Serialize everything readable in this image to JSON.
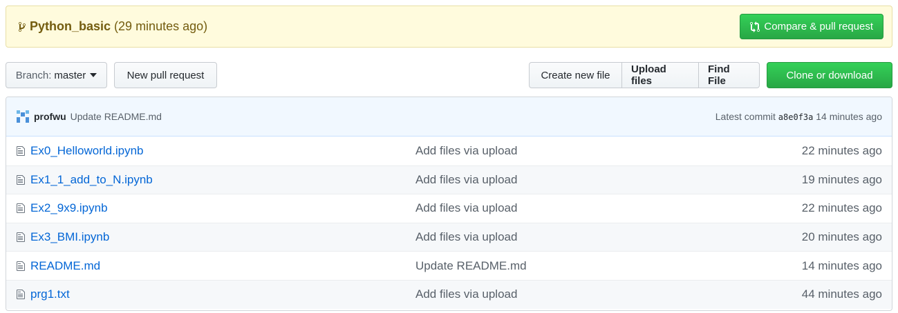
{
  "banner": {
    "branch_name": "Python_basic",
    "branch_time": "(29 minutes ago)",
    "compare_label": "Compare & pull request"
  },
  "toolbar": {
    "branch_prefix": "Branch:",
    "branch_value": "master",
    "new_pr_label": "New pull request",
    "create_file_label": "Create new file",
    "upload_files_label": "Upload files",
    "find_file_label": "Find File",
    "clone_label": "Clone or download"
  },
  "commit": {
    "author": "profwu",
    "message": "Update README.md",
    "latest_prefix": "Latest commit",
    "sha": "a8e0f3a",
    "time": "14 minutes ago"
  },
  "files": [
    {
      "name": "Ex0_Helloworld.ipynb",
      "message": "Add files via upload",
      "age": "22 minutes ago"
    },
    {
      "name": "Ex1_1_add_to_N.ipynb",
      "message": "Add files via upload",
      "age": "19 minutes ago"
    },
    {
      "name": "Ex2_9x9.ipynb",
      "message": "Add files via upload",
      "age": "22 minutes ago"
    },
    {
      "name": "Ex3_BMI.ipynb",
      "message": "Add files via upload",
      "age": "20 minutes ago"
    },
    {
      "name": "README.md",
      "message": "Update README.md",
      "age": "14 minutes ago"
    },
    {
      "name": "prg1.txt",
      "message": "Add files via upload",
      "age": "44 minutes ago"
    }
  ],
  "colors": {
    "link": "#0366d6",
    "green_button": "#28a745",
    "banner_bg": "#fffbdd",
    "commit_bar_bg": "#f1f8ff"
  },
  "icons": {
    "banner": "git-branch-icon",
    "compare": "git-compare-icon",
    "file": "file-text-icon"
  }
}
